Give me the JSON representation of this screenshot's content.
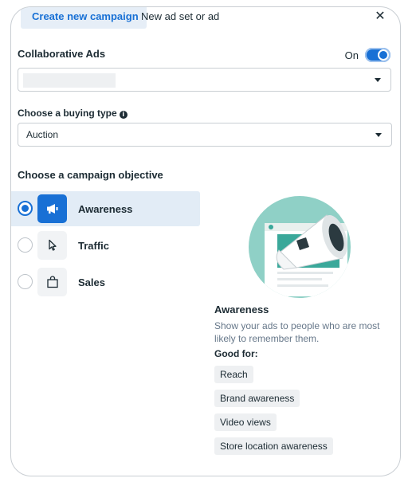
{
  "tabs": {
    "active": "Create new campaign",
    "other": "New ad set or ad"
  },
  "close_glyph": "✕",
  "collaborative": {
    "label": "Collaborative Ads",
    "toggle_label": "On",
    "toggle_on": true
  },
  "buying": {
    "label": "Choose a buying type",
    "info_glyph": "i",
    "value": "Auction"
  },
  "objective": {
    "label": "Choose a campaign objective",
    "items": [
      {
        "label": "Awareness",
        "icon": "megaphone-icon",
        "selected": true
      },
      {
        "label": "Traffic",
        "icon": "cursor-icon",
        "selected": false
      },
      {
        "label": "Sales",
        "icon": "shopping-bag-icon",
        "selected": false
      }
    ]
  },
  "details": {
    "title": "Awareness",
    "description": "Show your ads to people who are most likely to remember them.",
    "good_for_label": "Good for:",
    "good_for": [
      "Reach",
      "Brand awareness",
      "Video views",
      "Store location awareness"
    ]
  },
  "colors": {
    "accent": "#1870d5",
    "selected_bg": "#e2ecf6",
    "illustration_teal": "#3aa89a"
  }
}
